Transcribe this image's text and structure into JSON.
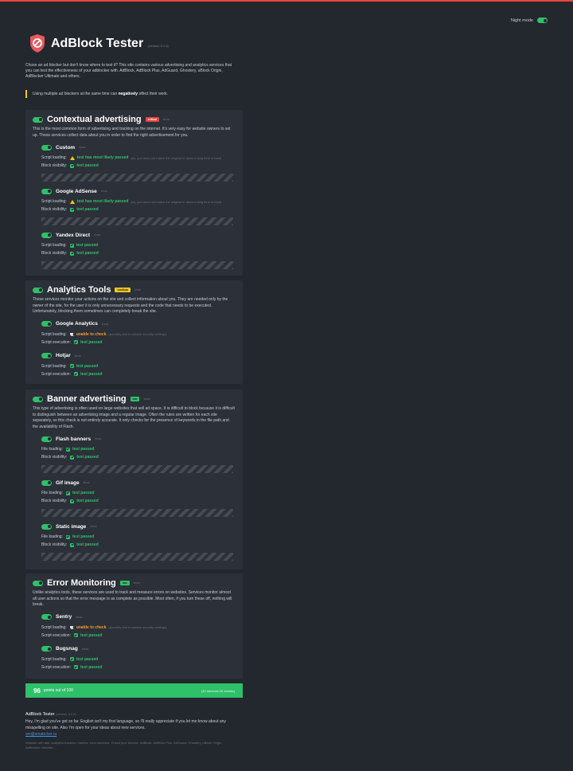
{
  "app": {
    "title": "AdBlock Tester",
    "version": "(version 3.1.0)",
    "night_mode_label": "Night mode",
    "intro": "Chose an ad blocker but don't know where to test it? This site contains various advertising and analytics services that you can test the effectiveness of your adblocker with. AdBlock, AdBlock Plus, AdGuard, Ghostery, uBlock Origin, AdBlocker Ultimate and others.",
    "warning_pre": "Using multiple ad blockers at the same time can ",
    "warning_bold": "negatively",
    "warning_post": " affect their work."
  },
  "labels": {
    "show": "show",
    "test_passed": "test passed",
    "likely_passed": "test has most likely passed",
    "likely_note": "(so, you does not match the original or takes a long time to load)",
    "unable": "unable to check",
    "unable_note": "(possibly due to service security settings)"
  },
  "sections": {
    "contextual": {
      "title": "Contextual advertising",
      "badge": "critical",
      "desc": "This is the most common form of advertising and tracking on the internet. It's very easy for website owners to set up. These services collect data about you in order to find the right advertisement for you.",
      "items": [
        {
          "name": "Custom",
          "row1": "Script loading:",
          "row2": "Block visibility:"
        },
        {
          "name": "Google AdSense",
          "row1": "Script loading:",
          "row2": "Block visibility:"
        },
        {
          "name": "Yandex Direct",
          "row1": "Script loading:",
          "row2": "Block visibility:"
        }
      ]
    },
    "analytics": {
      "title": "Analytics Tools",
      "badge": "medium",
      "desc": "These services monitor your actions on the site and collect information about you. They are needed only by the owner of the site, for the user it is only unnecessary requests and the code that needs to be executed. Unfortunately, blocking them sometimes can completely break the site.",
      "items": [
        {
          "name": "Google Analytics",
          "row1": "Script loading:",
          "row2": "Script execution:"
        },
        {
          "name": "Hotjar",
          "row1": "Script loading:",
          "row2": "Script execution:"
        }
      ]
    },
    "banner": {
      "title": "Banner advertising",
      "badge": "low",
      "desc": "This type of advertising is often used on large websites that sell ad space. It is difficult to block because it is difficult to distinguish between an advertising image and a regular image. Often the rules are written for each site separately, so this check is not entirely accurate. It only checks for the presence of keywords in the file path and the availability of Flash.",
      "items": [
        {
          "name": "Flash banners",
          "row1": "File loading:",
          "row2": "Block visibility:"
        },
        {
          "name": "Gif image",
          "row1": "File loading:",
          "row2": "Block visibility:"
        },
        {
          "name": "Static image",
          "row1": "File loading:",
          "row2": "Block visibility:"
        }
      ]
    },
    "error": {
      "title": "Error Monitoring",
      "badge": "low",
      "desc": "Unlike analytics tools, these services are used to track and measure errors on websites. Services monitor almost all user actions so that the error message is as complete as possible. Most often, if you turn these off, nothing will break.",
      "items": [
        {
          "name": "Sentry",
          "row1": "Script loading:",
          "row2": "Script execution:"
        },
        {
          "name": "Bugsnag",
          "row1": "Script loading:",
          "row2": "Script execution:"
        }
      ]
    }
  },
  "score": {
    "points": "96",
    "label": "points out of 100",
    "summary": "(10 services 20 checks)"
  },
  "footer": {
    "title": "AdBlock Tester",
    "version": "(version 3.1.0)",
    "text": "Hey, I'm glad you've got so far. English isn't my first language, so I'll really appreciate if you let me know about any misspelling on site. Also I'm open for your ideas about new services.",
    "email": "sm@smabcher.ru",
    "keywords": "Website with ads, analytics trackers, metrics, error catchers. Check your blocker: AdBlock, AdBlock Plus, AdGuard, Ghostery, uBlock Origin, AdBlocker Ultimate..."
  },
  "colors": {
    "accent": "#2fc06a",
    "critical": "#e8453c",
    "medium": "#f3c623",
    "background": "#23272e",
    "panel": "#2c3038"
  },
  "icons": {
    "logo": "shield-stop-icon",
    "warning": "warning-triangle-icon",
    "flag": "flag-icon",
    "check": "check-icon"
  }
}
